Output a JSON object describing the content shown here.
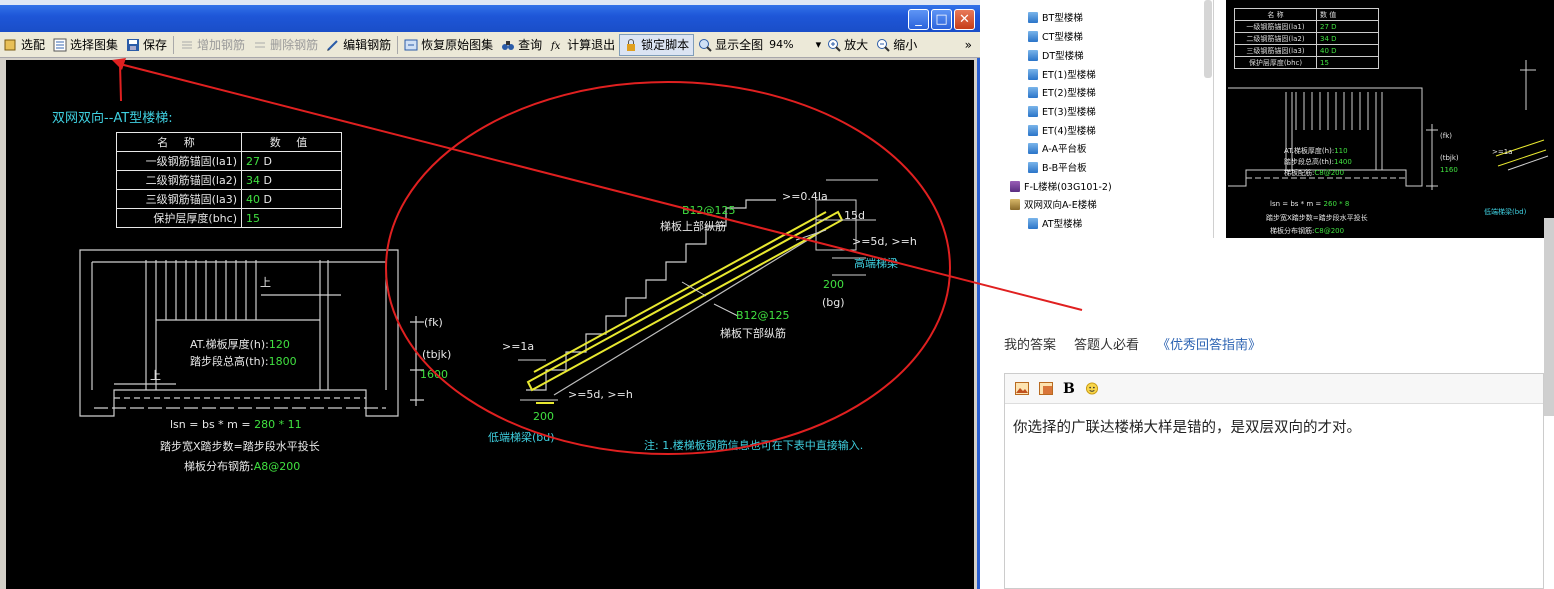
{
  "window": {
    "title": "",
    "controls": {
      "minimize": "_",
      "maximize": "□",
      "close": "✕"
    }
  },
  "toolbar": {
    "items": [
      {
        "label": "选配",
        "icon": "select-icon",
        "enabled": true
      },
      {
        "label": "选择图集",
        "icon": "atlas-icon",
        "enabled": true
      },
      {
        "label": "保存",
        "icon": "save-icon",
        "enabled": true
      },
      {
        "label": "增加钢筋",
        "icon": "add-rebar-icon",
        "enabled": false
      },
      {
        "label": "删除钢筋",
        "icon": "delete-rebar-icon",
        "enabled": false
      },
      {
        "label": "编辑钢筋",
        "icon": "edit-rebar-icon",
        "enabled": true
      },
      {
        "label": "恢复原始图集",
        "icon": "restore-icon",
        "enabled": true
      },
      {
        "label": "查询",
        "icon": "binoculars-icon",
        "enabled": true
      },
      {
        "label": "计算退出",
        "icon": "fx-icon",
        "enabled": true
      },
      {
        "label": "锁定脚本",
        "icon": "lock-icon",
        "enabled": true,
        "pressed": true
      },
      {
        "label": "显示全图",
        "icon": "fit-icon",
        "enabled": true
      },
      {
        "label": "放大",
        "icon": "zoom-in-icon",
        "enabled": true
      },
      {
        "label": "缩小",
        "icon": "zoom-out-icon",
        "enabled": true
      }
    ],
    "zoom_value": "94%",
    "overflow": "»"
  },
  "drawing": {
    "title": "双网双向--AT型楼梯:",
    "table": {
      "headers": [
        "名 称",
        "数 值"
      ],
      "rows": [
        {
          "name": "一级钢筋锚固(la1)",
          "value": "27",
          "unit": "D"
        },
        {
          "name": "二级钢筋锚固(la2)",
          "value": "34",
          "unit": "D"
        },
        {
          "name": "三级钢筋锚固(la3)",
          "value": "40",
          "unit": "D"
        },
        {
          "name": "保护层厚度(bhc)",
          "value": "15",
          "unit": ""
        }
      ]
    },
    "plan": {
      "up_label_1": "上",
      "up_label_2": "上",
      "thickness_label": "AT.梯板厚度(h):",
      "thickness_value": "120",
      "height_label": "踏步段总高(th):",
      "height_value": "1800",
      "fk": "(fk)",
      "tbjk": "(tbjk)",
      "tbjk_value": "1600",
      "lsn_label": "lsn = bs * m = ",
      "lsn_value": "280 * 11",
      "formula": "踏步宽X踏步数=踏步段水平投长",
      "dist_label": "梯板分布钢筋:",
      "dist_value": "A8@200"
    },
    "section": {
      "top_rebar_code": "B12@125",
      "top_rebar_label": "梯板上部纵筋",
      "bottom_rebar_code": "B12@125",
      "bottom_rebar_label": "梯板下部纵筋",
      "top_anchor": ">=0.4la",
      "five_d": "15d",
      "five_d_h_top": ">=5d, >=h",
      "high_beam": "高端梯梁",
      "dim_top": "200",
      "bg": "(bg)",
      "la": ">=1a",
      "five_d_h_bottom": ">=5d, >=h",
      "dim_bottom": "200",
      "low_beam": "低端梯梁(bd)"
    },
    "note": "注: 1.楼梯板钢筋信息也可在下表中直接输入."
  },
  "tree": {
    "items": [
      {
        "label": "BT型楼梯",
        "icon": "page-icon"
      },
      {
        "label": "CT型楼梯",
        "icon": "page-icon"
      },
      {
        "label": "DT型楼梯",
        "icon": "page-icon"
      },
      {
        "label": "ET(1)型楼梯",
        "icon": "page-icon"
      },
      {
        "label": "ET(2)型楼梯",
        "icon": "page-icon"
      },
      {
        "label": "ET(3)型楼梯",
        "icon": "page-icon"
      },
      {
        "label": "ET(4)型楼梯",
        "icon": "page-icon"
      },
      {
        "label": "A-A平台板",
        "icon": "page-icon"
      },
      {
        "label": "B-B平台板",
        "icon": "page-icon"
      },
      {
        "label": "F-L楼梯(03G101-2)",
        "icon": "book-icon"
      },
      {
        "label": "双网双向A-E楼梯",
        "icon": "open-book-icon"
      },
      {
        "label": "AT型楼梯",
        "icon": "page-icon"
      }
    ]
  },
  "preview": {
    "table": {
      "headers": [
        "名 称",
        "数 值"
      ],
      "rows": [
        {
          "name": "一级钢筋锚固(la1)",
          "value": "27 D"
        },
        {
          "name": "二级钢筋锚固(la2)",
          "value": "34 D"
        },
        {
          "name": "三级钢筋锚固(la3)",
          "value": "40 D"
        },
        {
          "name": "保护层厚度(bhc)",
          "value": "15"
        }
      ]
    },
    "thickness": "AT.梯板厚度(h):",
    "thickness_value": "110",
    "height": "踏步段总高(th):",
    "height_value": "1400",
    "dist": "梯板配筋:",
    "dist_value": "C8@200",
    "fk": "(fk)",
    "tbjk": "(tbjk)",
    "tbjk_value": "1160",
    "lsn": "lsn = bs * m = ",
    "lsn_value": "260 * 8",
    "formula": "踏步宽X踏步数=踏步段水平投长",
    "dist2": "梯板分布钢筋:",
    "dist2_value": "C8@200",
    "la": ">=1a",
    "low_beam": "低端梯梁(bd)"
  },
  "answer": {
    "tab_mine": "我的答案",
    "tab_must_read": "答题人必看",
    "tab_guide": "《优秀回答指南》",
    "editor_bold": "B",
    "content": "你选择的广联达楼梯大样是错的，是双层双向的才对。"
  },
  "colors": {
    "cad_bg": "#000000",
    "cad_cyan": "#3fd0e0",
    "cad_green": "#40e040",
    "cad_yellow": "#e0e040",
    "annotation_red": "#e02020",
    "link_blue": "#2d64b3"
  }
}
